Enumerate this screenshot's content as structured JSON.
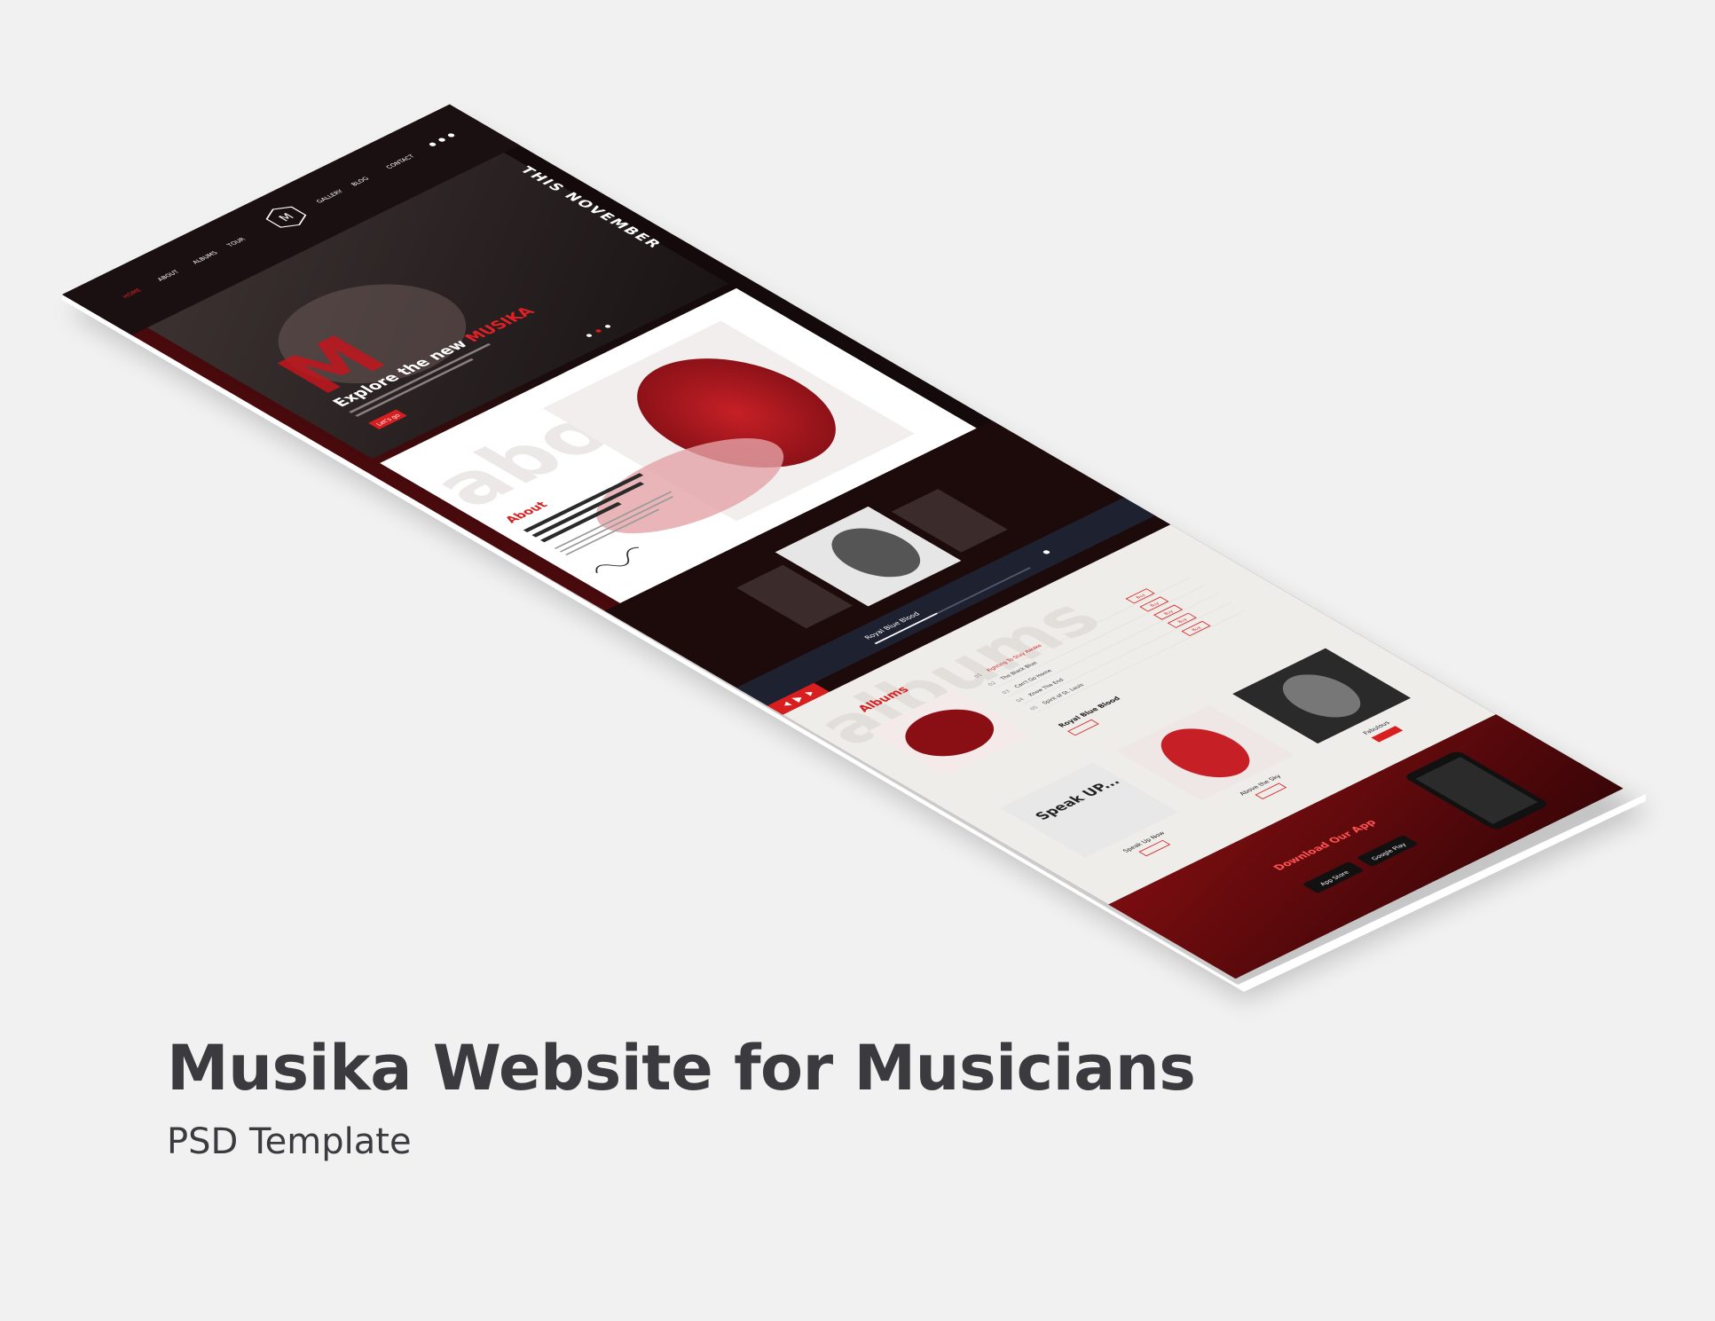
{
  "caption": {
    "title": "Musika Website for Musicians",
    "subtitle": "PSD Template"
  },
  "mockup": {
    "colors": {
      "background": "#f1f1f1",
      "dark": "#1a0d0e",
      "deep_red": "#5a0a0c",
      "accent": "#d81e1e",
      "light_panel": "#efedea",
      "player_bar": "#1e2230"
    },
    "nav": {
      "items": [
        "HOME",
        "ABOUT",
        "ALBUMS",
        "TOUR",
        "GALLERY",
        "BLOG",
        "CONTACT"
      ],
      "logo_letter": "M",
      "social_icons": [
        "facebook-icon",
        "twitter-icon",
        "instagram-icon"
      ]
    },
    "hero": {
      "heading_prefix": "Explore the new",
      "heading_brand": "MUSIKA",
      "button": "Let's go",
      "side_banner": "THIS NOVEMBER"
    },
    "about": {
      "title": "About",
      "bg_word": "about",
      "lead": "It is a long established fact that a reader will be distracted by the readable content of a page when looking at its layout."
    },
    "player": {
      "track_line": "Royal Blue Blood"
    },
    "albums": {
      "title": "Albums",
      "bg_word": "albums",
      "tracks": [
        {
          "no": "01",
          "name": "Fighting To Stay Awake"
        },
        {
          "no": "02",
          "name": "The Black Blue"
        },
        {
          "no": "03",
          "name": "Can't Go Home"
        },
        {
          "no": "04",
          "name": "Know The End"
        },
        {
          "no": "05",
          "name": "Spirit of St. Louis"
        }
      ],
      "buy_label": "Buy",
      "featured_album": "Royal Blue Blood",
      "cards": [
        {
          "name": "Speak Up Now",
          "cover_text": "Speak UP..."
        },
        {
          "name": "Above the Sky"
        },
        {
          "name": "Fabulous"
        }
      ]
    },
    "download": {
      "title": "Download Our App",
      "app_store": "App Store",
      "google_play": "Google Play"
    }
  }
}
